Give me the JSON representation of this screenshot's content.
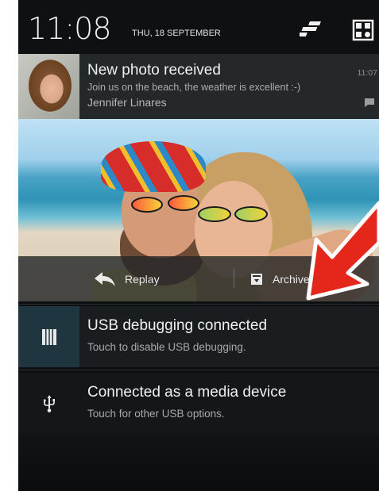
{
  "status_bar": {
    "time": "11:08",
    "date": "THU, 18 SEPTEMBER"
  },
  "notifications": [
    {
      "title": "New photo received",
      "text": "Join us on the beach, the weather is excellent :-)",
      "sub": "Jennifer Linares",
      "time": "11:07",
      "actions": {
        "replay": "Replay",
        "archive": "Archive"
      }
    },
    {
      "title": "USB debugging connected",
      "text": "Touch to disable USB debugging."
    },
    {
      "title": "Connected as a media device",
      "text": "Touch for other USB options."
    }
  ],
  "colors": {
    "accent_arrow": "#e4261b",
    "usb_debug_icon_bg": "#1f3641"
  },
  "icons": [
    "quick-settings-toggle-icon",
    "profile-grid-icon",
    "chat-icon",
    "reply-icon",
    "archive-icon",
    "usb-debug-icon",
    "usb-icon"
  ]
}
